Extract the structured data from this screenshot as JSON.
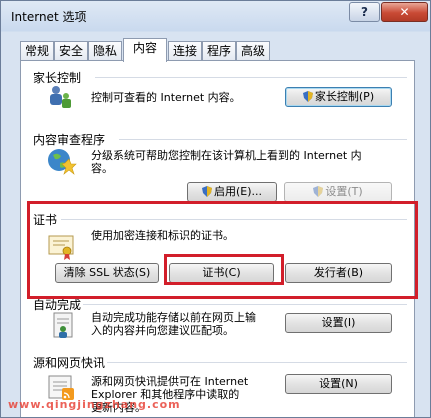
{
  "window": {
    "title": "Internet 选项",
    "help_label": "?",
    "close_label": "✕"
  },
  "tabs": [
    {
      "label": "常规"
    },
    {
      "label": "安全"
    },
    {
      "label": "隐私"
    },
    {
      "label": "内容",
      "active": true
    },
    {
      "label": "连接"
    },
    {
      "label": "程序"
    },
    {
      "label": "高级"
    }
  ],
  "parental": {
    "heading": "家长控制",
    "desc": "控制可查看的 Internet 内容。",
    "button": "家长控制(P)"
  },
  "advisor": {
    "heading": "内容审查程序",
    "desc_line1": "分级系统可帮助您控制在该计算机上看到的 Internet 内",
    "desc_line2": "容。",
    "enable_button": "启用(E)...",
    "settings_button": "设置(T)"
  },
  "certificates": {
    "heading": "证书",
    "desc": "使用加密连接和标识的证书。",
    "clear_ssl_button": "清除 SSL 状态(S)",
    "certificates_button": "证书(C)",
    "publishers_button": "发行者(B)"
  },
  "autocomplete": {
    "heading": "自动完成",
    "desc_line1": "自动完成功能存储以前在网页上输",
    "desc_line2": "入的内容并向您建议匹配项。",
    "settings_button": "设置(I)"
  },
  "feeds": {
    "heading": "源和网页快讯",
    "desc_line1": "源和网页快讯提供可在 Internet",
    "desc_line2": "Explorer 和其他程序中读取的",
    "desc_line3": "更新内容。",
    "settings_button": "设置(N)"
  },
  "watermark": "www.qingjingzhang.com",
  "colors": {
    "highlight_box": "#d21e2a",
    "close_button": "#c94a35"
  }
}
